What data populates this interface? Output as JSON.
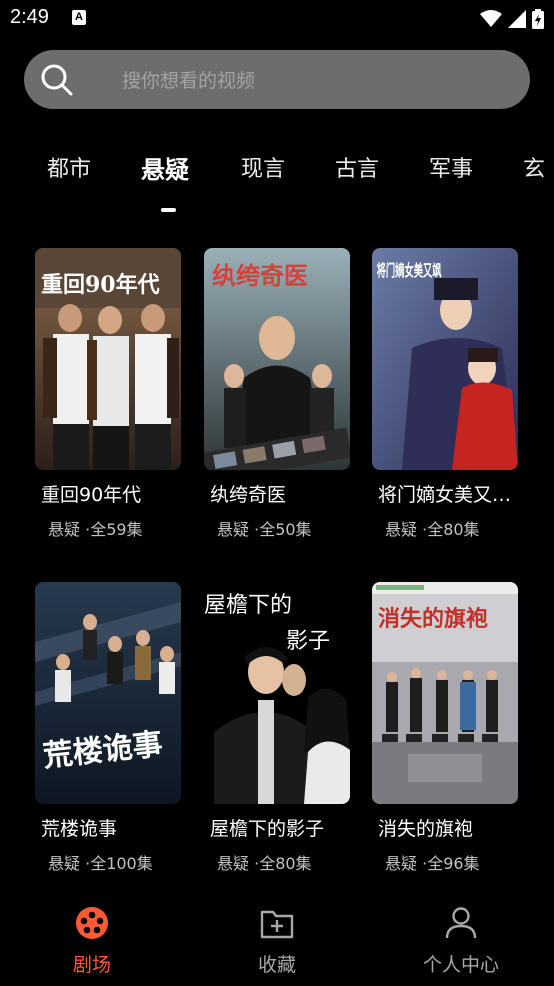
{
  "status_bar": {
    "time": "2:49",
    "notification_icon": "A"
  },
  "search": {
    "placeholder": "搜你想看的视频"
  },
  "tabs": [
    {
      "label": "都市"
    },
    {
      "label": "悬疑"
    },
    {
      "label": "现言"
    },
    {
      "label": "古言"
    },
    {
      "label": "军事"
    },
    {
      "label": "玄"
    }
  ],
  "active_tab": "悬疑",
  "videos": [
    {
      "title": "重回90年代",
      "poster_text": "重回90年代",
      "genre": "悬疑",
      "episodes": "·全59集"
    },
    {
      "title": "纨绔奇医",
      "poster_text": "纨绔奇医",
      "genre": "悬疑",
      "episodes": "·全50集"
    },
    {
      "title": "将门嫡女美又…",
      "poster_text": "将门嫡女美又飒",
      "genre": "悬疑",
      "episodes": "·全80集"
    },
    {
      "title": "荒楼诡事",
      "poster_text": "荒楼诡事",
      "genre": "悬疑",
      "episodes": "·全100集"
    },
    {
      "title": "屋檐下的影子",
      "poster_text_1": "屋檐下的",
      "poster_text_2": "影子",
      "genre": "悬疑",
      "episodes": "·全80集"
    },
    {
      "title": "消失的旗袍",
      "poster_text": "消失的旗袍",
      "genre": "悬疑",
      "episodes": "·全96集"
    }
  ],
  "bottom_nav": [
    {
      "label": "剧场",
      "icon": "theater-reel-icon"
    },
    {
      "label": "收藏",
      "icon": "folder-add-icon"
    },
    {
      "label": "个人中心",
      "icon": "person-icon"
    }
  ],
  "colors": {
    "accent": "#ff5a33",
    "search_bg": "#6d6d6d",
    "background": "#000000"
  }
}
